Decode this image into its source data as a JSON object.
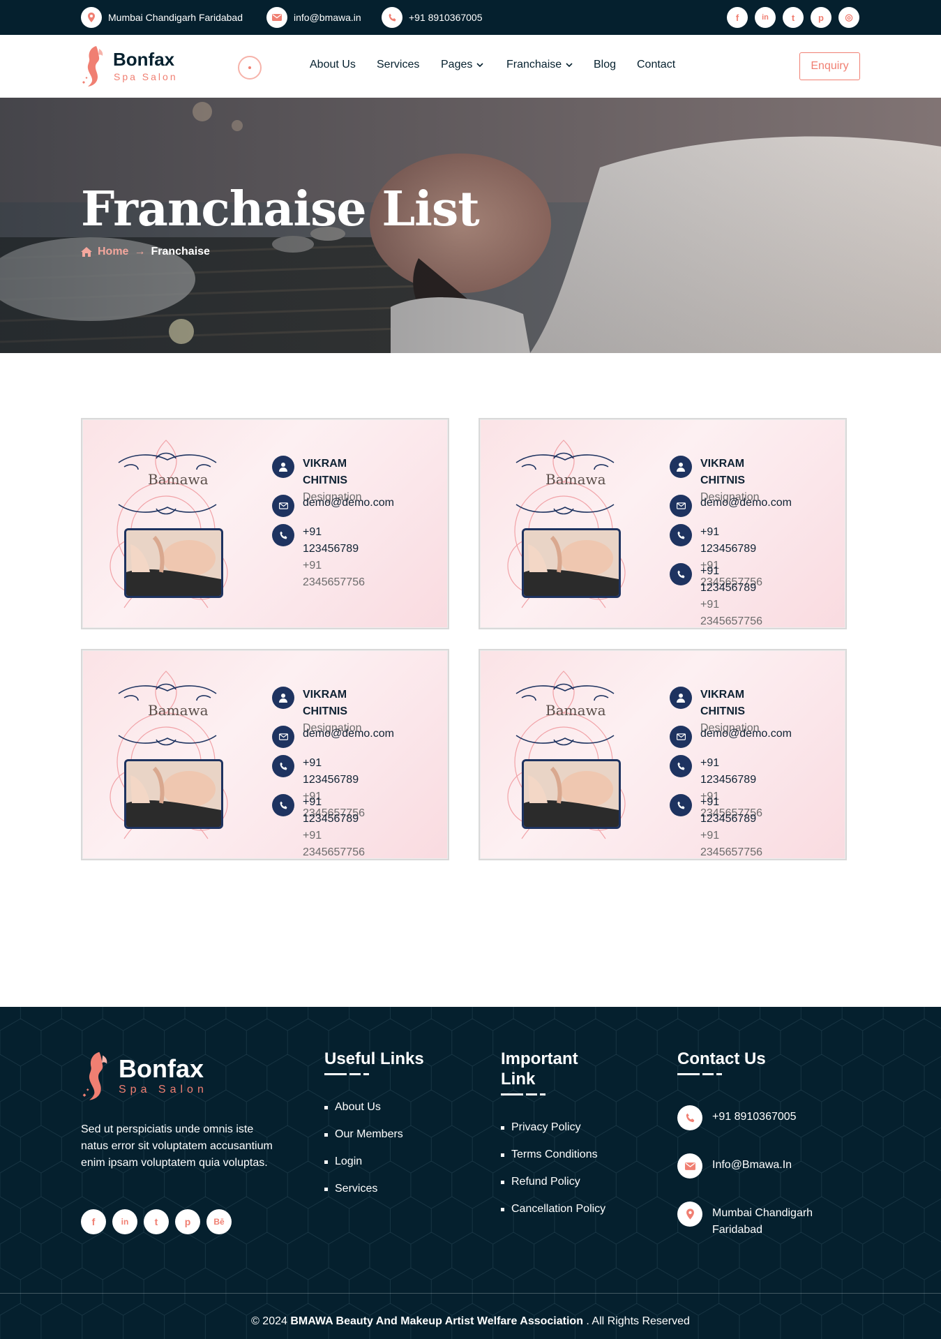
{
  "topbar": {
    "address": "Mumbai Chandigarh Faridabad",
    "email": "info@bmawa.in",
    "phone": "+91 8910367005",
    "social": [
      {
        "icon": "facebook-icon",
        "glyph": "f"
      },
      {
        "icon": "linkedin-icon",
        "glyph": "in"
      },
      {
        "icon": "twitter-icon",
        "glyph": "t"
      },
      {
        "icon": "pinterest-icon",
        "glyph": "p"
      },
      {
        "icon": "instagram-icon",
        "glyph": "◎"
      }
    ]
  },
  "brand": {
    "name": "Bonfax",
    "tagline": "Spa Salon"
  },
  "nav": {
    "items": [
      {
        "label": "About Us"
      },
      {
        "label": "Services"
      },
      {
        "label": "Pages"
      },
      {
        "label": "Franchaise"
      },
      {
        "label": "Blog"
      },
      {
        "label": "Contact"
      }
    ],
    "enquiry_label": "Enquiry"
  },
  "hero": {
    "title": "Franchaise List",
    "breadcrumb_home": "Home",
    "breadcrumb_current": "Franchaise"
  },
  "cards": [
    {
      "brand": "Bamawa",
      "name": "VIKRAM CHITNIS",
      "designation": "Designation",
      "email": "demo@demo.com",
      "phones": [
        {
          "primary": "+91 123456789",
          "secondary": "+91 2345657756"
        }
      ]
    },
    {
      "brand": "Bamawa",
      "name": "VIKRAM CHITNIS",
      "designation": "Designation",
      "email": "demo@demo.com",
      "phones": [
        {
          "primary": "+91 123456789",
          "secondary": "+91 2345657756"
        },
        {
          "primary": "+91 123456789",
          "secondary": "+91 2345657756"
        }
      ]
    },
    {
      "brand": "Bamawa",
      "name": "VIKRAM CHITNIS",
      "designation": "Designation",
      "email": "demo@demo.com",
      "phones": [
        {
          "primary": "+91 123456789",
          "secondary": "+91 2345657756"
        },
        {
          "primary": "+91 123456789",
          "secondary": "+91 2345657756"
        }
      ]
    },
    {
      "brand": "Bamawa",
      "name": "VIKRAM CHITNIS",
      "designation": "Designation",
      "email": "demo@demo.com",
      "phones": [
        {
          "primary": "+91 123456789",
          "secondary": "+91 2345657756"
        },
        {
          "primary": "+91 123456789",
          "secondary": "+91 2345657756"
        }
      ]
    }
  ],
  "footer": {
    "about": "Sed ut perspiciatis unde omnis iste natus error sit voluptatem accusantium enim ipsam voluptatem quia voluptas.",
    "social": [
      {
        "icon": "facebook-icon",
        "glyph": "f"
      },
      {
        "icon": "linkedin-icon",
        "glyph": "in"
      },
      {
        "icon": "twitter-icon",
        "glyph": "t"
      },
      {
        "icon": "pinterest-icon",
        "glyph": "p"
      },
      {
        "icon": "behance-icon",
        "glyph": "Bē"
      }
    ],
    "useful_links": {
      "title": "Useful Links",
      "items": [
        "About Us",
        "Our Members",
        "Login",
        "Services"
      ]
    },
    "important_link": {
      "title_line1": "Important",
      "title_line2": "Link",
      "items": [
        "Privacy Policy",
        "Terms Conditions",
        "Refund Policy",
        "Cancellation Policy"
      ]
    },
    "contact": {
      "title": "Contact Us",
      "phone": "+91 8910367005",
      "email": "Info@Bmawa.In",
      "address_line1": "Mumbai Chandigarh",
      "address_line2": "Faridabad"
    },
    "copyright_prefix": "© 2024",
    "copyright_org": "BMAWA Beauty And Makeup Artist Welfare Association",
    "copyright_suffix": ". All Rights Reserved"
  },
  "colors": {
    "dark": "#05202e",
    "accent": "#f07f72",
    "card_icon": "#1e3360"
  }
}
